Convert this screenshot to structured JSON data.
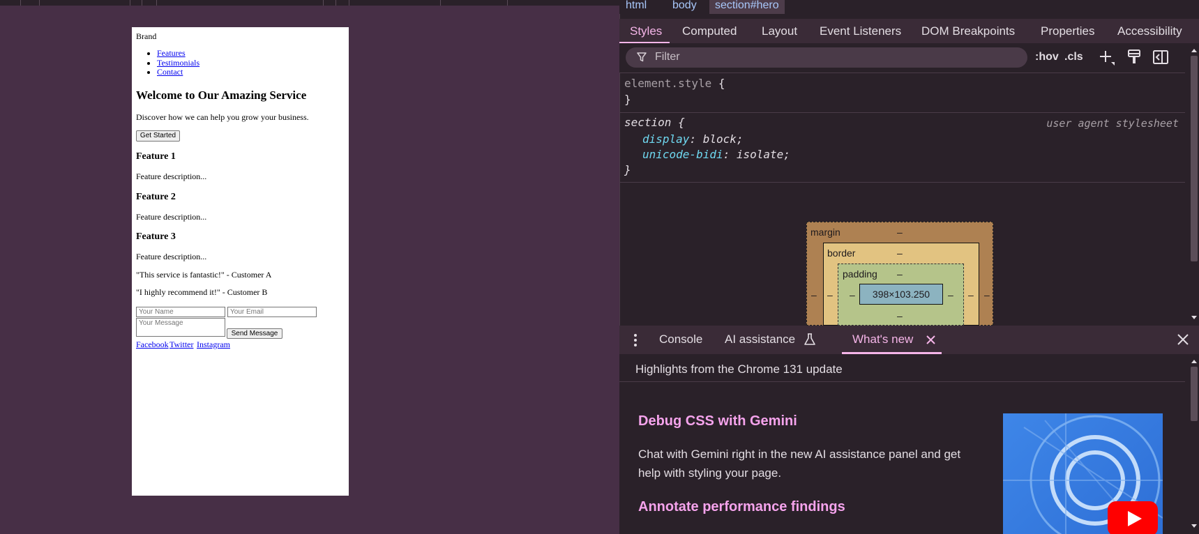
{
  "page": {
    "brand": "Brand",
    "nav": [
      "Features",
      "Testimonials",
      "Contact"
    ],
    "hero_title": "Welcome to Our Amazing Service",
    "hero_text": "Discover how we can help you grow your business.",
    "cta_label": "Get Started",
    "features": [
      {
        "title": "Feature 1",
        "desc": "Feature description..."
      },
      {
        "title": "Feature 2",
        "desc": "Feature description..."
      },
      {
        "title": "Feature 3",
        "desc": "Feature description..."
      }
    ],
    "testimonials": [
      "\"This service is fantastic!\" - Customer A",
      "\"I highly recommend it!\" - Customer B"
    ],
    "form": {
      "name_placeholder": "Your Name",
      "email_placeholder": "Your Email",
      "message_placeholder": "Your Message",
      "send_label": "Send Message"
    },
    "social": [
      "Facebook",
      "Twitter",
      "Instagram"
    ]
  },
  "devtools": {
    "breadcrumbs": [
      "html",
      "body",
      "section#hero"
    ],
    "tabs": [
      "Styles",
      "Computed",
      "Layout",
      "Event Listeners",
      "DOM Breakpoints",
      "Properties",
      "Accessibility"
    ],
    "active_tab": "Styles",
    "filter_placeholder": "Filter",
    "toolbar": {
      "hov": ":hov",
      "cls": ".cls"
    },
    "rules": {
      "element_style": "element.style",
      "section_selector": "section",
      "source": "user agent stylesheet",
      "declarations": [
        {
          "prop": "display",
          "value": "block"
        },
        {
          "prop": "unicode-bidi",
          "value": "isolate"
        }
      ]
    },
    "box_model": {
      "margin_label": "margin",
      "border_label": "border",
      "padding_label": "padding",
      "content_size": "398×103.250",
      "dash": "–"
    },
    "drawer": {
      "tabs": [
        "Console",
        "AI assistance",
        "What's new"
      ],
      "active_tab": "What's new",
      "highlights": "Highlights from the Chrome 131 update",
      "items": [
        {
          "title": "Debug CSS with Gemini",
          "text": "Chat with Gemini right in the new AI assistance panel and get help with styling your page."
        },
        {
          "title": "Annotate performance findings"
        }
      ]
    }
  },
  "colors": {
    "viewport_bg": "#472f46",
    "devtools_bg": "#2a2129",
    "accent": "#f5b5e8",
    "link": "#a8c7fa"
  }
}
